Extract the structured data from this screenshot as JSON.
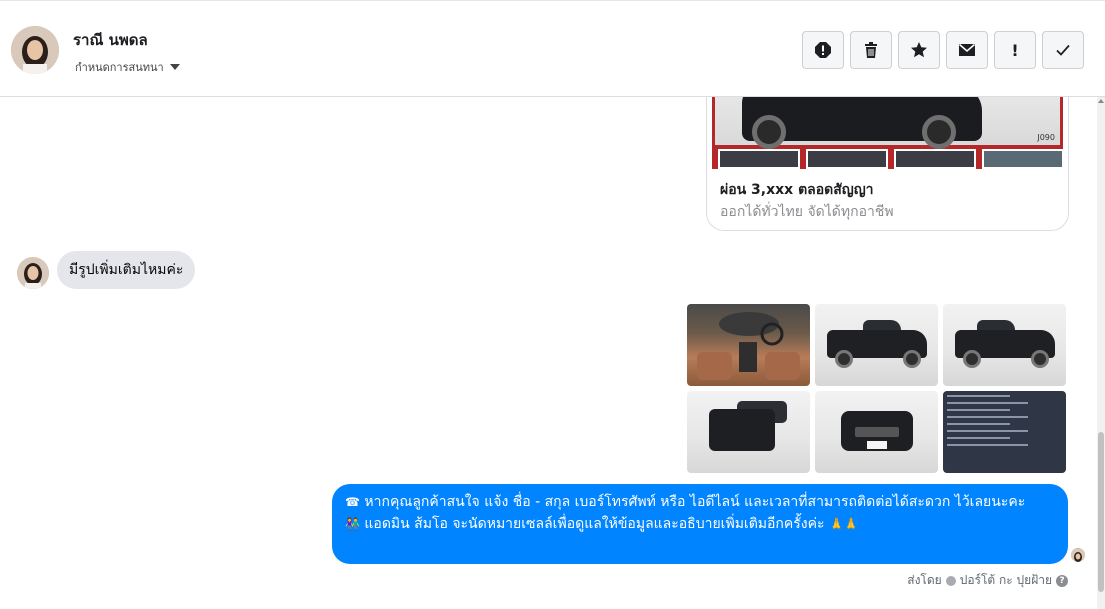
{
  "header": {
    "name": "ราณี นพดล",
    "assign_label": "กำหนดการสนทนา",
    "actions": [
      "spam",
      "delete",
      "star",
      "mark-unread",
      "follow-up",
      "done"
    ]
  },
  "ad_card": {
    "title": "ผ่อน 3,xxx ตลอดสัญญา",
    "subtitle": "ออกได้ทั่วไทย จัดได้ทุกอาชีพ",
    "watermark": "J090"
  },
  "incoming": {
    "text": "มีรูปเพิ่มเติมไหมค่ะ"
  },
  "photos": [
    {
      "kind": "interior"
    },
    {
      "kind": "side"
    },
    {
      "kind": "side"
    },
    {
      "kind": "rear"
    },
    {
      "kind": "front"
    },
    {
      "kind": "document"
    }
  ],
  "outgoing": {
    "line1": "หากคุณลูกค้าสนใจ แจ้ง ชื่อ - สกุล เบอร์โทรศัพท์ หรือ ไอดีไลน์ และเวลาที่สามารถติดต่อได้สะดวก ไว้เลยนะคะ",
    "line2": "แอดมิน ส้มโอ จะนัดหมายเซลล์เพื่อดูแลให้ข้อมูลและอธิบายเพิ่มเติมอีกครั้งค่ะ",
    "emoji1": "☎",
    "emoji2": "👫",
    "emoji3": "🙏🙏"
  },
  "footer": {
    "sent_by": "ส่งโดย",
    "author": "ปอร์โต้ กะ ปุยฝ้าย",
    "help": "?"
  },
  "colors": {
    "brand_blue": "#0084ff",
    "incoming_bg": "#e4e6eb",
    "card_red": "#b5282a"
  }
}
